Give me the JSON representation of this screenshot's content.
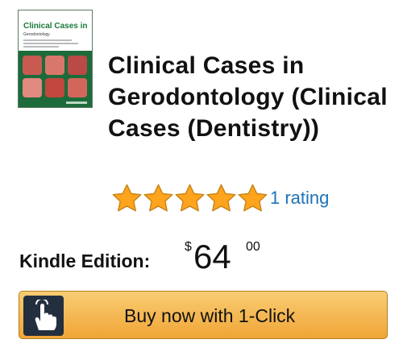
{
  "book": {
    "cover": {
      "series_text": "Clinical Cases in",
      "subtitle_text": "Gerodontology",
      "background_color": "#1d6b3a",
      "accent_color": "#1a7a3c"
    },
    "title": "Clinical Cases in Gerodontology (Clinical Cases (Dentistry))"
  },
  "rating": {
    "stars": 5,
    "max_stars": 5,
    "star_color": "#ffa41c",
    "link_text": "1 rating",
    "link_color": "#1e73b8"
  },
  "offer": {
    "format_label": "Kindle Edition:",
    "price_symbol": "$",
    "price_whole": "64",
    "price_fraction": "00"
  },
  "buy_button": {
    "label": "Buy now with 1-Click",
    "icon": "tap-hand-icon"
  }
}
